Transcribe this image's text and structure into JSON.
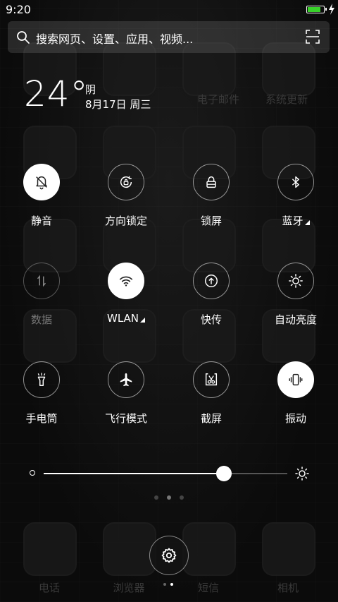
{
  "status_bar": {
    "time": "9:20",
    "battery_level": 0.85,
    "battery_color": "#38d22a"
  },
  "search": {
    "placeholder": "搜索网页、设置、应用、视频..."
  },
  "weather": {
    "temperature": "24°",
    "condition": "阴",
    "date": "8月17日 周三"
  },
  "toggles": [
    {
      "label": "静音",
      "icon": "bell-off-icon",
      "active": true
    },
    {
      "label": "方向锁定",
      "icon": "rotation-lock-icon",
      "active": false
    },
    {
      "label": "锁屏",
      "icon": "lock-icon",
      "active": false
    },
    {
      "label": "蓝牙",
      "icon": "bluetooth-icon",
      "active": false,
      "has_more": true
    },
    {
      "label": "数据",
      "icon": "mobile-data-icon",
      "active": false,
      "disabled": true
    },
    {
      "label": "WLAN",
      "icon": "wifi-icon",
      "active": true,
      "has_more": true
    },
    {
      "label": "快传",
      "icon": "transfer-icon",
      "active": false
    },
    {
      "label": "自动亮度",
      "icon": "auto-brightness-icon",
      "active": false
    },
    {
      "label": "手电筒",
      "icon": "flashlight-icon",
      "active": false
    },
    {
      "label": "飞行模式",
      "icon": "airplane-icon",
      "active": false
    },
    {
      "label": "截屏",
      "icon": "screenshot-icon",
      "active": false
    },
    {
      "label": "振动",
      "icon": "vibrate-icon",
      "active": true
    }
  ],
  "brightness": {
    "level": 0.74
  },
  "pager": {
    "count": 3,
    "active": 1
  },
  "home_screen": {
    "labels_row1": [
      "电子邮件",
      "系统更新"
    ],
    "dock": [
      "电话",
      "浏览器",
      "短信",
      "相机"
    ]
  }
}
